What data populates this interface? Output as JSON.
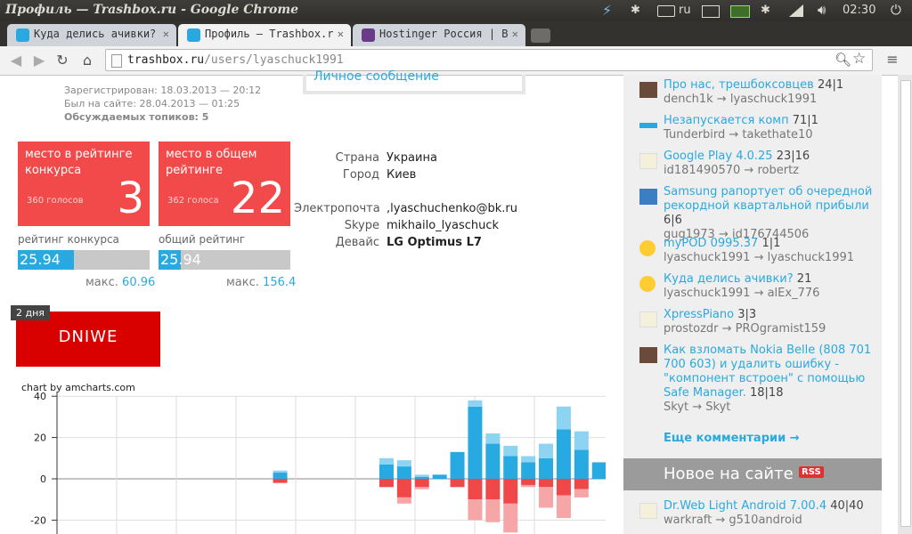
{
  "system": {
    "window_title": "Профиль — Trashbox.ru - Google Chrome",
    "lang": "ru",
    "time": "02:30"
  },
  "tabs": [
    {
      "label": "Куда делись ачивки?",
      "active": false,
      "icon": "trashbox-icon"
    },
    {
      "label": "Профиль — Trashbox.r",
      "active": true,
      "icon": "trashbox-icon"
    },
    {
      "label": "Hostinger Россия | В",
      "active": false,
      "icon": "hostinger-icon"
    }
  ],
  "toolbar": {
    "url_domain": "trashbox.ru",
    "url_path": "/users/lyaschuck1991"
  },
  "profile": {
    "registered": "Зарегистрирован: 18.03.2013 — 20:12",
    "last_seen": "Был на сайте: 28.04.2013 — 01:25",
    "topics": "Обсуждаемых топиков: 5",
    "private_message": "Личное сообщение",
    "rating_contest": {
      "label": "место в рейтинге конкурса",
      "votes": "360 голосов",
      "place": "3",
      "caption": "рейтинг конкурса",
      "value": "25.94",
      "max_label": "макс.",
      "max": "60.96",
      "fill": 0.4255
    },
    "rating_total": {
      "label": "место в общем рейтинге",
      "votes": "362 голоса",
      "place": "22",
      "caption": "общий рейтинг",
      "value": "25.94",
      "max_label": "макс.",
      "max": "156.4",
      "fill": 0.1659
    },
    "info": [
      {
        "key": "Страна",
        "value": "Украина"
      },
      {
        "key": "Город",
        "value": "Киев"
      },
      {
        "key": "Электропочта",
        "value": ",lyaschuchenko@bk.ru"
      },
      {
        "key": "Skype",
        "value": "mikhailo_lyaschuck"
      },
      {
        "key": "Девайс",
        "value": "LG Optimus L7"
      }
    ],
    "badge_days": "2 дня",
    "banner": "DNIWE",
    "chart_credit": "chart by amcharts.com"
  },
  "chart_data": {
    "type": "bar",
    "ylim": [
      -25,
      40
    ],
    "yticks": [
      "40",
      "20",
      "0",
      "-20"
    ],
    "grid": true,
    "series": [
      {
        "values": [
          0,
          0,
          0,
          0,
          0,
          0,
          0,
          0,
          0,
          0,
          0,
          0,
          0,
          0,
          3,
          0,
          0,
          0,
          0,
          0,
          7,
          6,
          1,
          2,
          13,
          35,
          17,
          11,
          8,
          10,
          24,
          14,
          8
        ]
      },
      {
        "values": [
          0,
          0,
          0,
          0,
          0,
          0,
          0,
          0,
          0,
          0,
          0,
          0,
          0,
          0,
          -2,
          0,
          0,
          0,
          0,
          0,
          -4,
          -9,
          -4,
          0,
          -4,
          -10,
          -10,
          -12,
          -3,
          -4,
          -8,
          -5,
          0
        ]
      }
    ],
    "light_series": [
      {
        "values": [
          0,
          0,
          0,
          0,
          0,
          0,
          0,
          0,
          0,
          0,
          0,
          0,
          0,
          0,
          1,
          0,
          0,
          0,
          0,
          0,
          3,
          3,
          1,
          0,
          0,
          3,
          5,
          5,
          3,
          7,
          11,
          9,
          0
        ]
      },
      {
        "values": [
          0,
          0,
          0,
          0,
          0,
          0,
          0,
          0,
          0,
          0,
          0,
          0,
          0,
          0,
          0,
          0,
          0,
          0,
          0,
          0,
          0,
          -3,
          -1,
          0,
          0,
          -10,
          -11,
          -14,
          -1,
          -10,
          -11,
          -4,
          0
        ]
      }
    ],
    "colors": {
      "pos": "#27aae1",
      "pos_light": "#8dd4f2",
      "neg": "#f04848",
      "neg_light": "#f6a6a6"
    }
  },
  "sidebar": {
    "comments": [
      {
        "title": "Про нас, трешбоксовцев",
        "count": "24|1",
        "meta": "dench1k → lyaschuck1991",
        "icon": "avatar-icon"
      },
      {
        "title": "Незапускается комп",
        "count": "71|1",
        "meta": "Tunderbird → takethate10",
        "icon": "topic-icon"
      },
      {
        "title": "Google Play 4.0.25",
        "count": "23|16",
        "meta": "id181490570 → robertz",
        "icon": "app-icon"
      },
      {
        "title": "Samsung рапортует об очередной рекордной квартальной прибыли",
        "count": "6|6",
        "meta": "gug1973 → id176744506",
        "icon": "news-icon"
      },
      {
        "title": "myPOD 0995.37",
        "count": "1|1",
        "meta": "lyaschuck1991 → lyaschuck1991",
        "icon": "smiley-icon"
      },
      {
        "title": "Куда делись ачивки?",
        "count": "21",
        "meta": "lyaschuck1991 → alEx_776",
        "icon": "smiley-icon"
      },
      {
        "title": "XpressPiano",
        "count": "3|3",
        "meta": "prostozdr → PROgramist159",
        "icon": "app-icon"
      },
      {
        "title": "Как взломать Nokia Belle (808 701 700 603) и удалить ошибку - \"компонент встроен\" с помощью Safe Manager.",
        "count": "18|18",
        "meta": "Skyt → Skyt",
        "icon": "avatar-icon"
      }
    ],
    "more_comments": "Еще комментарии →",
    "new_heading": "Новое на сайте",
    "rss": "RSS",
    "new_items": [
      {
        "title": "Dr.Web Light Android 7.00.4",
        "count": "40|40",
        "meta": "warkraft → g510android",
        "icon": "app-icon"
      }
    ]
  }
}
